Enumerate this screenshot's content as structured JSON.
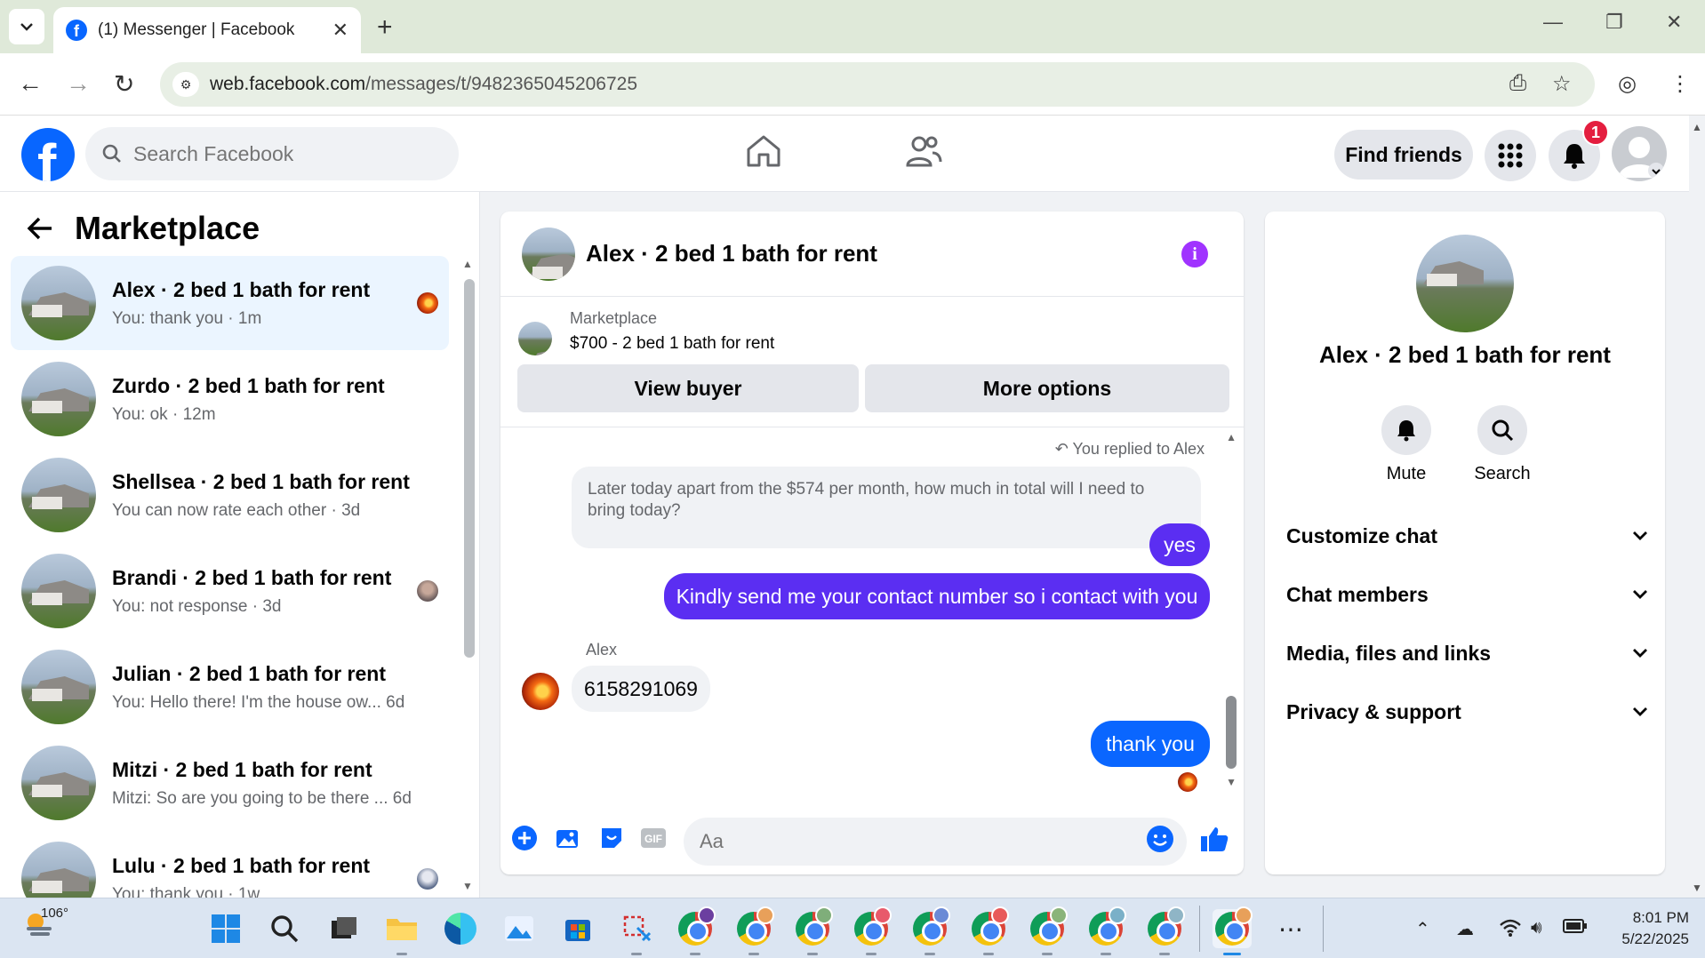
{
  "browser": {
    "tab_title": "(1) Messenger | Facebook",
    "url_domain": "web.facebook.com",
    "url_path": "/messages/t/9482365045206725"
  },
  "fb": {
    "search_placeholder": "Search Facebook",
    "find_friends": "Find friends",
    "notif_count": "1"
  },
  "sidebar": {
    "title": "Marketplace",
    "conversations": [
      {
        "name": "Alex · 2 bed 1 bath for rent",
        "preview": "You: thank you · 1m"
      },
      {
        "name": "Zurdo · 2 bed 1 bath for rent",
        "preview": "You: ok · 12m"
      },
      {
        "name": "Shellsea · 2 bed 1 bath for rent",
        "preview": "You can now rate each other · 3d"
      },
      {
        "name": "Brandi · 2 bed 1 bath for rent",
        "preview": "You: not response · 3d"
      },
      {
        "name": "Julian · 2 bed 1 bath for rent",
        "preview": "You: Hello there! I'm the house ow...   6d"
      },
      {
        "name": "Mitzi · 2 bed 1 bath for rent",
        "preview": "Mitzi: So are you going to be there ...   6d"
      },
      {
        "name": "Lulu · 2 bed 1 bath for rent",
        "preview": "You: thank you · 1w"
      }
    ]
  },
  "chat": {
    "title": "Alex · 2 bed 1 bath for rent",
    "listing_category": "Marketplace",
    "listing_title": "$700 - 2 bed 1 bath for rent",
    "view_buyer": "View buyer",
    "more_options": "More options",
    "replied_note": "You replied to Alex",
    "quoted_message": "Later today apart from the $574 per month, how much in total will I need to bring today?",
    "msg_yes": "yes",
    "msg_contact": "Kindly send me your contact number so i contact with you",
    "sender_name": "Alex",
    "msg_number": "6158291069",
    "msg_thanks": "thank you",
    "composer_placeholder": "Aa",
    "accent_color": "#0a66ff",
    "purple_color": "#5b2ef2"
  },
  "details": {
    "name": "Alex · 2 bed 1 bath for rent",
    "mute": "Mute",
    "search": "Search",
    "sections": [
      "Customize chat",
      "Chat members",
      "Media, files and links",
      "Privacy & support"
    ]
  },
  "taskbar": {
    "weather_temp": "106°",
    "time": "8:01 PM",
    "date": "5/22/2025"
  }
}
